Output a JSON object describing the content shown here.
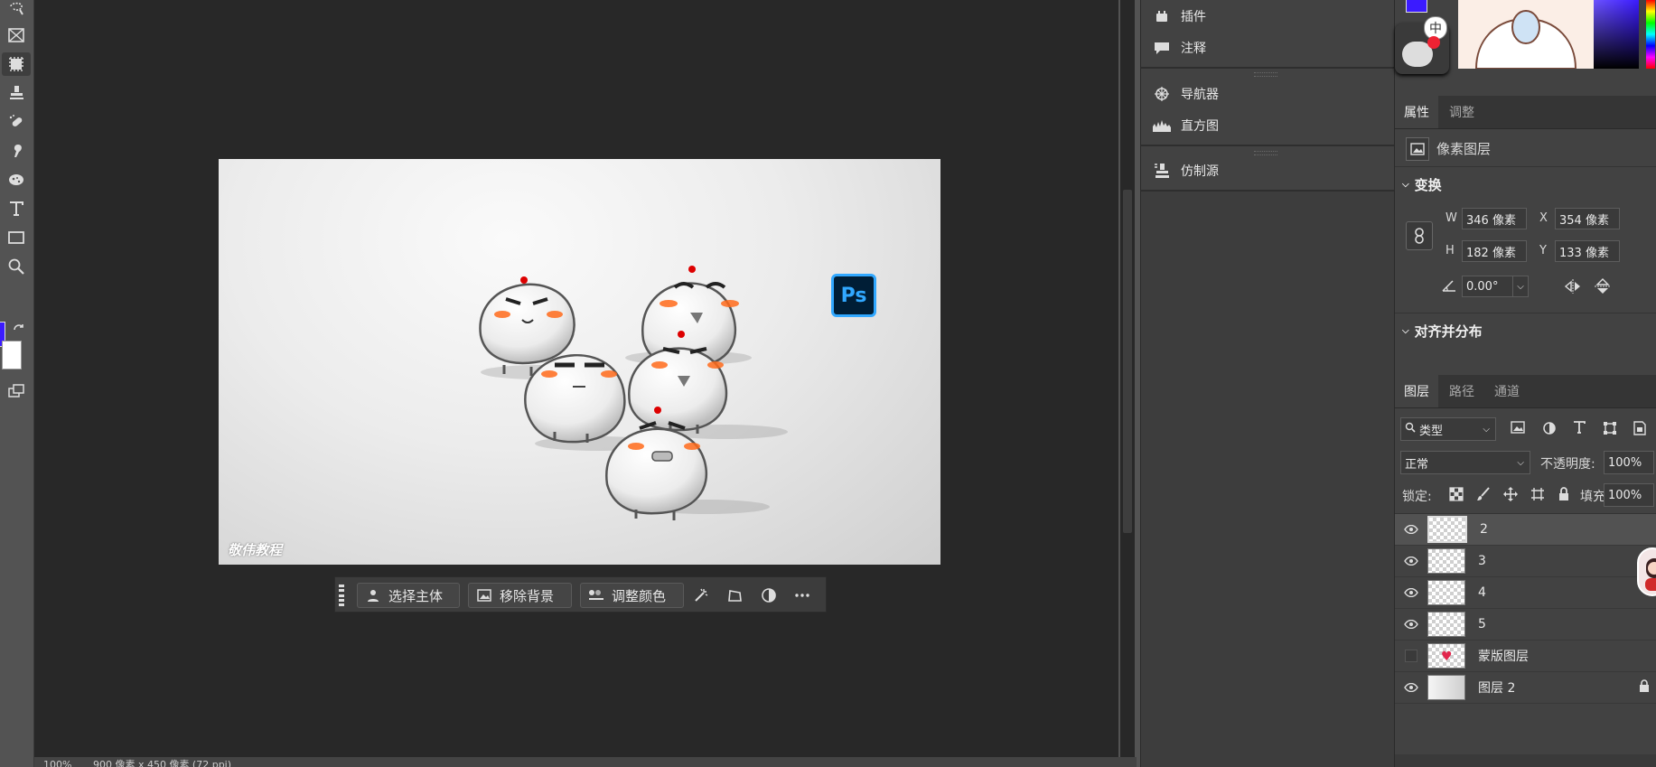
{
  "toolbar": {
    "tools": [
      "lasso-icon",
      "frame-icon",
      "content-aware-icon",
      "stamp-icon",
      "healing-icon",
      "smudge-icon",
      "sponge-icon",
      "type-icon",
      "rectangle-icon",
      "zoom-icon"
    ],
    "foreground_color": "#3b1bff",
    "background_color": "#ffffff"
  },
  "canvas": {
    "watermark": "敬伟教程",
    "badge": "Ps"
  },
  "contextbar": {
    "select_subject": "选择主体",
    "remove_background": "移除背景",
    "adjust_color": "调整颜色"
  },
  "status": {
    "zoom": "100%",
    "size": "900 像素 x 450 像素 (72 ppi)"
  },
  "midpanel": {
    "items": [
      {
        "label": "插件",
        "icon": "plugin-icon"
      },
      {
        "label": "注释",
        "icon": "comment-icon"
      },
      {
        "label": "导航器",
        "icon": "navigator-icon"
      },
      {
        "label": "直方图",
        "icon": "histogram-icon"
      },
      {
        "label": "仿制源",
        "icon": "clone-source-icon"
      }
    ]
  },
  "properties": {
    "tabs": [
      "属性",
      "调整"
    ],
    "layer_type": "像素图层",
    "transform_title": "变换",
    "w_label": "W",
    "w_value": "346 像素",
    "h_label": "H",
    "h_value": "182 像素",
    "x_label": "X",
    "x_value": "354 像素",
    "y_label": "Y",
    "y_value": "133 像素",
    "angle_value": "0.00°",
    "align_title": "对齐并分布"
  },
  "layers_panel": {
    "tabs": [
      "图层",
      "路径",
      "通道"
    ],
    "filter_label": "类型",
    "blend_mode": "正常",
    "opacity_label": "不透明度:",
    "opacity_value": "100%",
    "lock_label": "锁定:",
    "fill_label": "填充:",
    "fill_value": "100%",
    "layers": [
      {
        "name": "2",
        "visible": true,
        "selected": true
      },
      {
        "name": "3",
        "visible": true,
        "selected": false
      },
      {
        "name": "4",
        "visible": true,
        "selected": false
      },
      {
        "name": "5",
        "visible": true,
        "selected": false
      },
      {
        "name": "蒙版图层",
        "visible": false,
        "selected": false
      },
      {
        "name": "图层 2",
        "visible": true,
        "selected": false
      }
    ]
  },
  "ime": {
    "mode": "中"
  }
}
